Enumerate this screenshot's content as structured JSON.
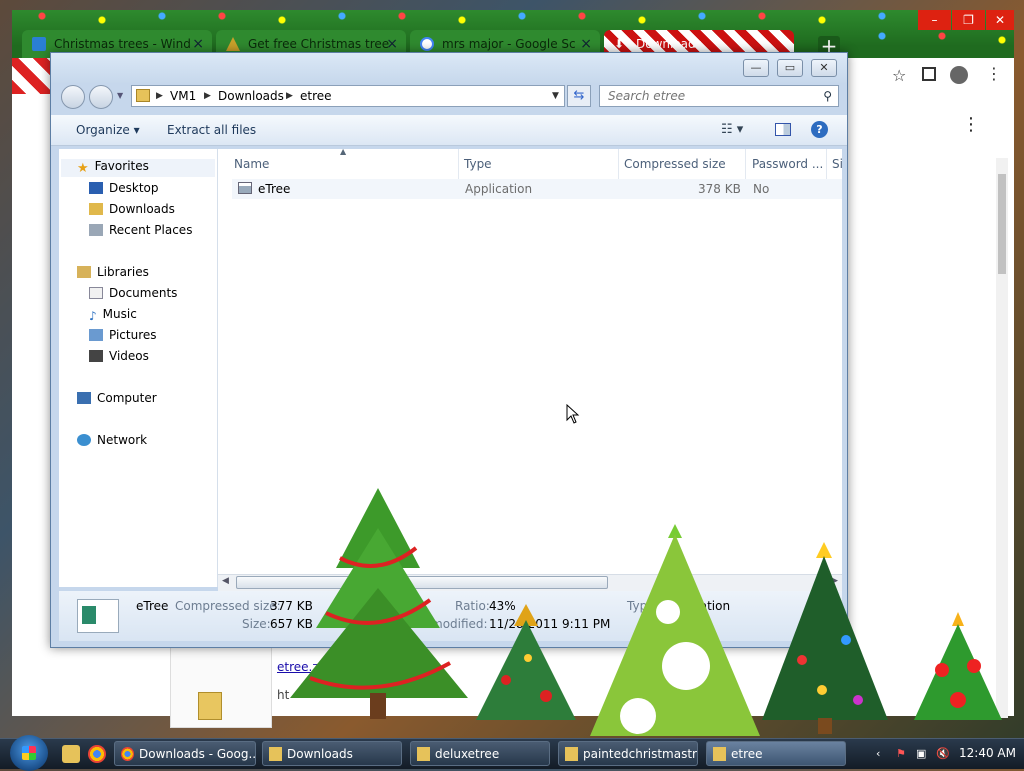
{
  "browser": {
    "tabs": [
      {
        "label": "Christmas trees - Wind",
        "active": false
      },
      {
        "label": "Get free Christmas tree",
        "active": false
      },
      {
        "label": "mrs major - Google Sc",
        "active": false
      },
      {
        "label": "Downloads",
        "active": true
      }
    ],
    "new_tab": "+",
    "window_buttons": {
      "minimize": "–",
      "maximize": "❐",
      "close": "✕"
    },
    "page_link": "etree.z",
    "page_sub": "ht"
  },
  "explorer": {
    "window_buttons": {
      "minimize": "—",
      "maximize": "▭",
      "close": "✕"
    },
    "breadcrumb": [
      "VM1",
      "Downloads",
      "etree"
    ],
    "search_placeholder": "Search etree",
    "commands": {
      "organize": "Organize ▾",
      "extract": "Extract all files"
    },
    "nav": {
      "favorites": "Favorites",
      "favorite_items": [
        "Desktop",
        "Downloads",
        "Recent Places"
      ],
      "libraries": "Libraries",
      "library_items": [
        "Documents",
        "Music",
        "Pictures",
        "Videos"
      ],
      "computer": "Computer",
      "network": "Network"
    },
    "columns": [
      "Name",
      "Type",
      "Compressed size",
      "Password ...",
      "Si"
    ],
    "files": [
      {
        "name": "eTree",
        "type": "Application",
        "compressed": "378 KB",
        "password": "No"
      }
    ],
    "details": {
      "name": "eTree",
      "compressed_label": "Compressed size:",
      "compressed_value": "377 KB",
      "size_label": "Size:",
      "size_value": "657 KB",
      "ratio_label": "Ratio:",
      "ratio_value": "43%",
      "modified_label": "modified:",
      "modified_value": "11/28/2011 9:11 PM",
      "type_label": "Type:",
      "type_value": "Application"
    }
  },
  "taskbar": {
    "items": [
      {
        "label": "Downloads - Goog...",
        "active": false
      },
      {
        "label": "Downloads",
        "active": false
      },
      {
        "label": "deluxetree",
        "active": false
      },
      {
        "label": "paintedchristmastr...",
        "active": false
      },
      {
        "label": "etree",
        "active": true
      }
    ],
    "clock": "12:40 AM"
  },
  "colors": {
    "chrome_green": "#1f6b1f",
    "explorer_frame": "#c6d7ec",
    "taskbar": "#1c2733"
  }
}
